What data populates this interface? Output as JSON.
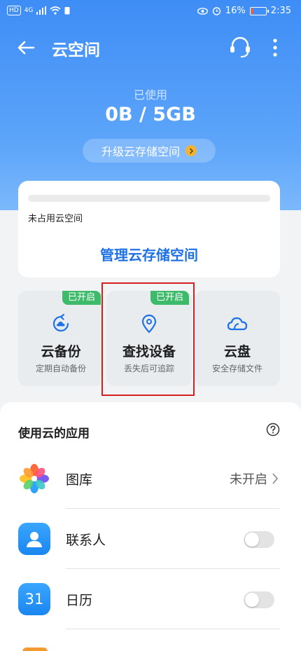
{
  "status_bar": {
    "network_badge": "HD",
    "signal_text": "4G",
    "battery_percent": "16%",
    "time": "2:35",
    "battery_level": 0.16
  },
  "nav": {
    "title": "云空间"
  },
  "usage": {
    "used_label": "已使用",
    "used_value": "0B / 5GB",
    "upgrade_label": "升级云存储空间",
    "used_fraction": 0
  },
  "storage_card": {
    "unused_label": "未占用云空间",
    "manage_label": "管理云存储空间"
  },
  "features": [
    {
      "title": "云备份",
      "subtitle": "定期自动备份",
      "badge": "已开启"
    },
    {
      "title": "查找设备",
      "subtitle": "丢失后可追踪",
      "badge": "已开启"
    },
    {
      "title": "云盘",
      "subtitle": "安全存储文件",
      "badge": ""
    }
  ],
  "apps_section": {
    "title": "使用云的应用",
    "items": [
      {
        "label": "图库",
        "status": "未开启",
        "control": "link"
      },
      {
        "label": "联系人",
        "enabled": false,
        "control": "toggle"
      },
      {
        "label": "日历",
        "icon_text": "31",
        "enabled": false,
        "control": "toggle"
      }
    ]
  },
  "colors": {
    "header_blue": "#3e8df6",
    "link_blue": "#1f72e6",
    "badge_green": "#3dbb6b",
    "highlight_red": "#d62020",
    "upgrade_dot": "#f2b233"
  }
}
